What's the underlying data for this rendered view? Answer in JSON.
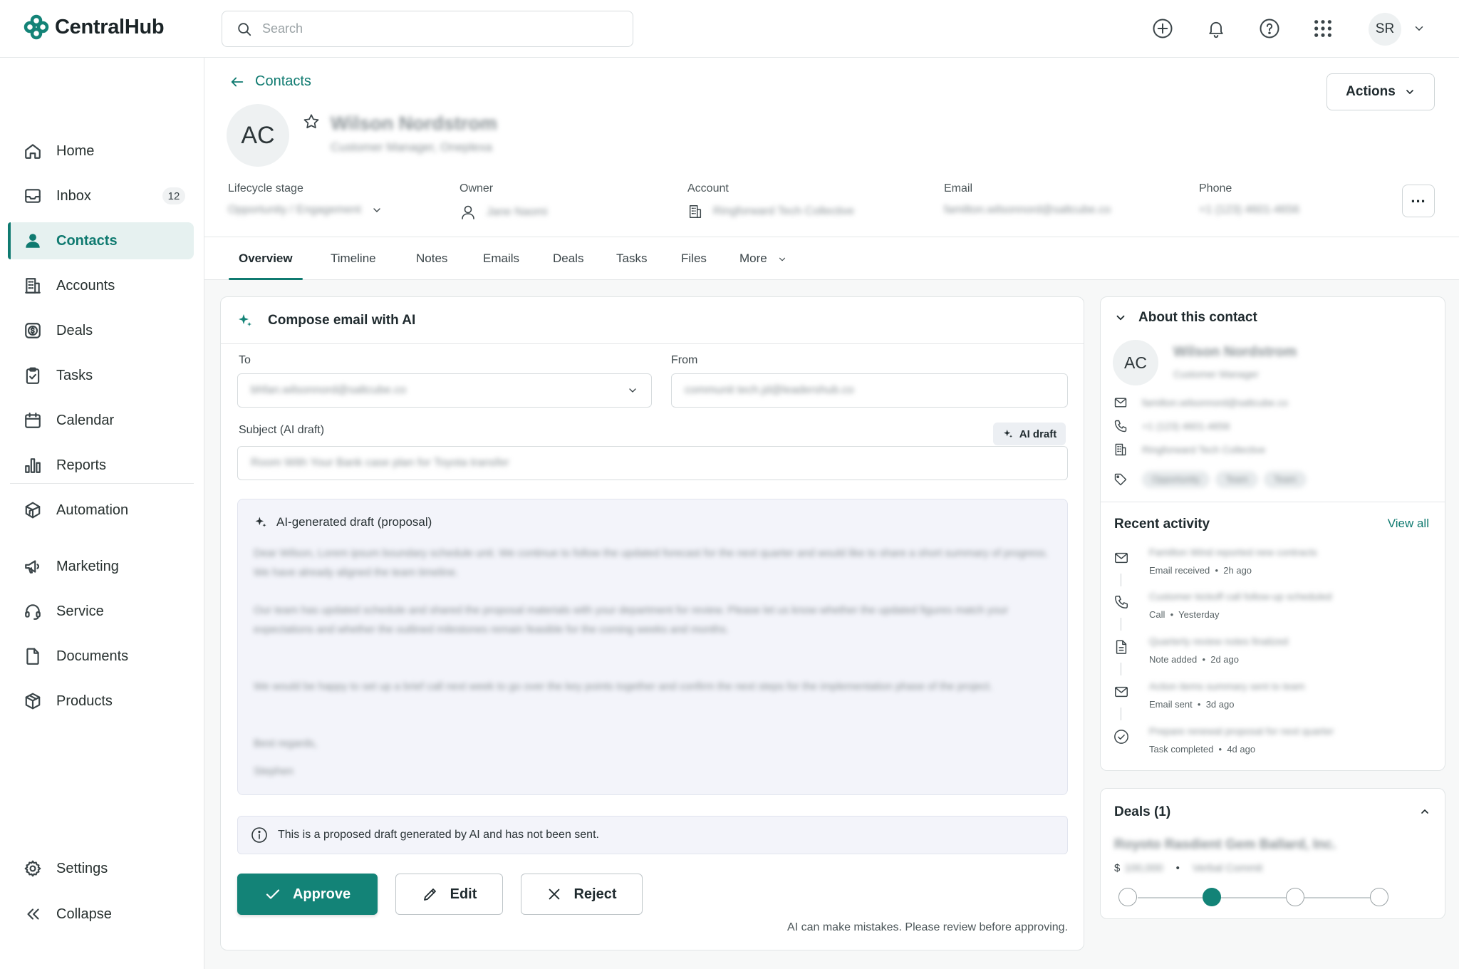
{
  "app": {
    "name": "CentralHub",
    "user_initials": "SR",
    "brand_color": "#138377"
  },
  "search": {
    "placeholder": "Search"
  },
  "top_icons": [
    "plus-circle-icon",
    "bell-icon",
    "help-icon",
    "apps-grid-icon"
  ],
  "sidebar": {
    "items": [
      {
        "label": "Home",
        "icon": "home-icon"
      },
      {
        "label": "Inbox",
        "icon": "inbox-icon",
        "badge": "12"
      },
      {
        "label": "Contacts",
        "icon": "user-icon",
        "active": true
      },
      {
        "label": "Accounts",
        "icon": "building-icon"
      },
      {
        "label": "Deals",
        "icon": "dollar-icon"
      },
      {
        "label": "Tasks",
        "icon": "clipboard-icon"
      },
      {
        "label": "Calendar",
        "icon": "calendar-icon"
      },
      {
        "label": "Reports",
        "icon": "bar-chart-icon"
      },
      {
        "label": "Automation",
        "icon": "automation-icon"
      },
      {
        "label": "Marketing",
        "icon": "megaphone-icon"
      },
      {
        "label": "Service",
        "icon": "headset-icon"
      },
      {
        "label": "Documents",
        "icon": "document-icon"
      },
      {
        "label": "Products",
        "icon": "box-icon"
      }
    ],
    "settings": "Settings",
    "collapse": "Collapse"
  },
  "header": {
    "back_label": "Contacts",
    "actions_label": "Actions",
    "initials": "AC",
    "name": "Wilson Nordstrom",
    "title": "Customer Manager, Oneplexa",
    "fields": [
      {
        "label": "Lifecycle stage",
        "value": "Opportunity / Engagement"
      },
      {
        "label": "Owner",
        "value": "Jane Naomi"
      },
      {
        "label": "Account",
        "value": "Ringforward Tech Collective"
      },
      {
        "label": "Email",
        "value": "familton.wilsonnord@saltcube.co"
      },
      {
        "label": "Phone",
        "value": "+1 (123) 4601-4656"
      }
    ],
    "more_label": "..."
  },
  "tabs": [
    "Overview",
    "Timeline",
    "Notes",
    "Emails",
    "Deals",
    "Tasks",
    "Files",
    "More"
  ],
  "compose": {
    "title": "Compose email with AI",
    "to_label": "To",
    "to_value": "bhfan.wilsonnord@saltcube.co",
    "from_label": "From",
    "from_value": "communit tech.jd@leadershub.co",
    "subject_label": "Subject (AI draft)",
    "ai_draft_label": "AI draft",
    "subject_value": "Room With Your Bank case plan for Toyota transfer",
    "draft_heading": "AI-generated draft (proposal)",
    "draft_paragraphs": [
      "Dear Wilson, Lorem ipsum boundary schedule unit. We continue to follow the updated forecast for the next quarter and would like to share a short summary of progress. We have already aligned the team timeline.",
      "Our team has updated schedule and shared the proposal materials with your department for review. Please let us know whether the updated figures match your expectations and whether the outlined milestones remain feasible for the coming weeks and months.",
      "We would be happy to set up a brief call next week to go over the key points together and confirm the next steps for the implementation phase of the project.",
      "Best regards,",
      "Stephen"
    ],
    "notice": "This is a proposed draft generated by AI and has not been sent.",
    "approve_label": "Approve",
    "edit_label": "Edit",
    "reject_label": "Reject",
    "disclaimer": "AI can make mistakes. Please review before approving."
  },
  "about": {
    "title": "About this contact",
    "initials": "AC",
    "name": "Wilson Nordstrom",
    "role": "Customer Manager",
    "email": "familton.wilsonnord@saltcube.co",
    "phone": "+1 (123) 4601-4656",
    "company": "Ringforward Tech Collective",
    "tags": [
      "Opportunity",
      "Team",
      "Team"
    ]
  },
  "activity": {
    "title": "Recent activity",
    "view_all": "View all",
    "items": [
      {
        "icon": "mail-icon",
        "title": "Familton Wind reported new contracts",
        "type": "Email received",
        "time": "2h ago"
      },
      {
        "icon": "phone-icon",
        "title": "Customer kickoff call follow-up scheduled",
        "type": "Call",
        "time": "Yesterday"
      },
      {
        "icon": "note-icon",
        "title": "Quarterly review notes finalized",
        "type": "Note added",
        "time": "2d ago"
      },
      {
        "icon": "mail-icon",
        "title": "Action items summary sent to team",
        "type": "Email sent",
        "time": "3d ago"
      },
      {
        "icon": "check-circle-icon",
        "title": "Prepare renewal proposal for next quarter",
        "type": "Task completed",
        "time": "4d ago"
      }
    ]
  },
  "deals": {
    "title": "Deals (1)",
    "deal_name": "Royoto Rasdient Gem Ballard, Inc.",
    "amount_prefix": "$",
    "amount": "100,000",
    "stage_label": "Verbal Commit",
    "stages_total": 4,
    "current_stage": 2
  }
}
